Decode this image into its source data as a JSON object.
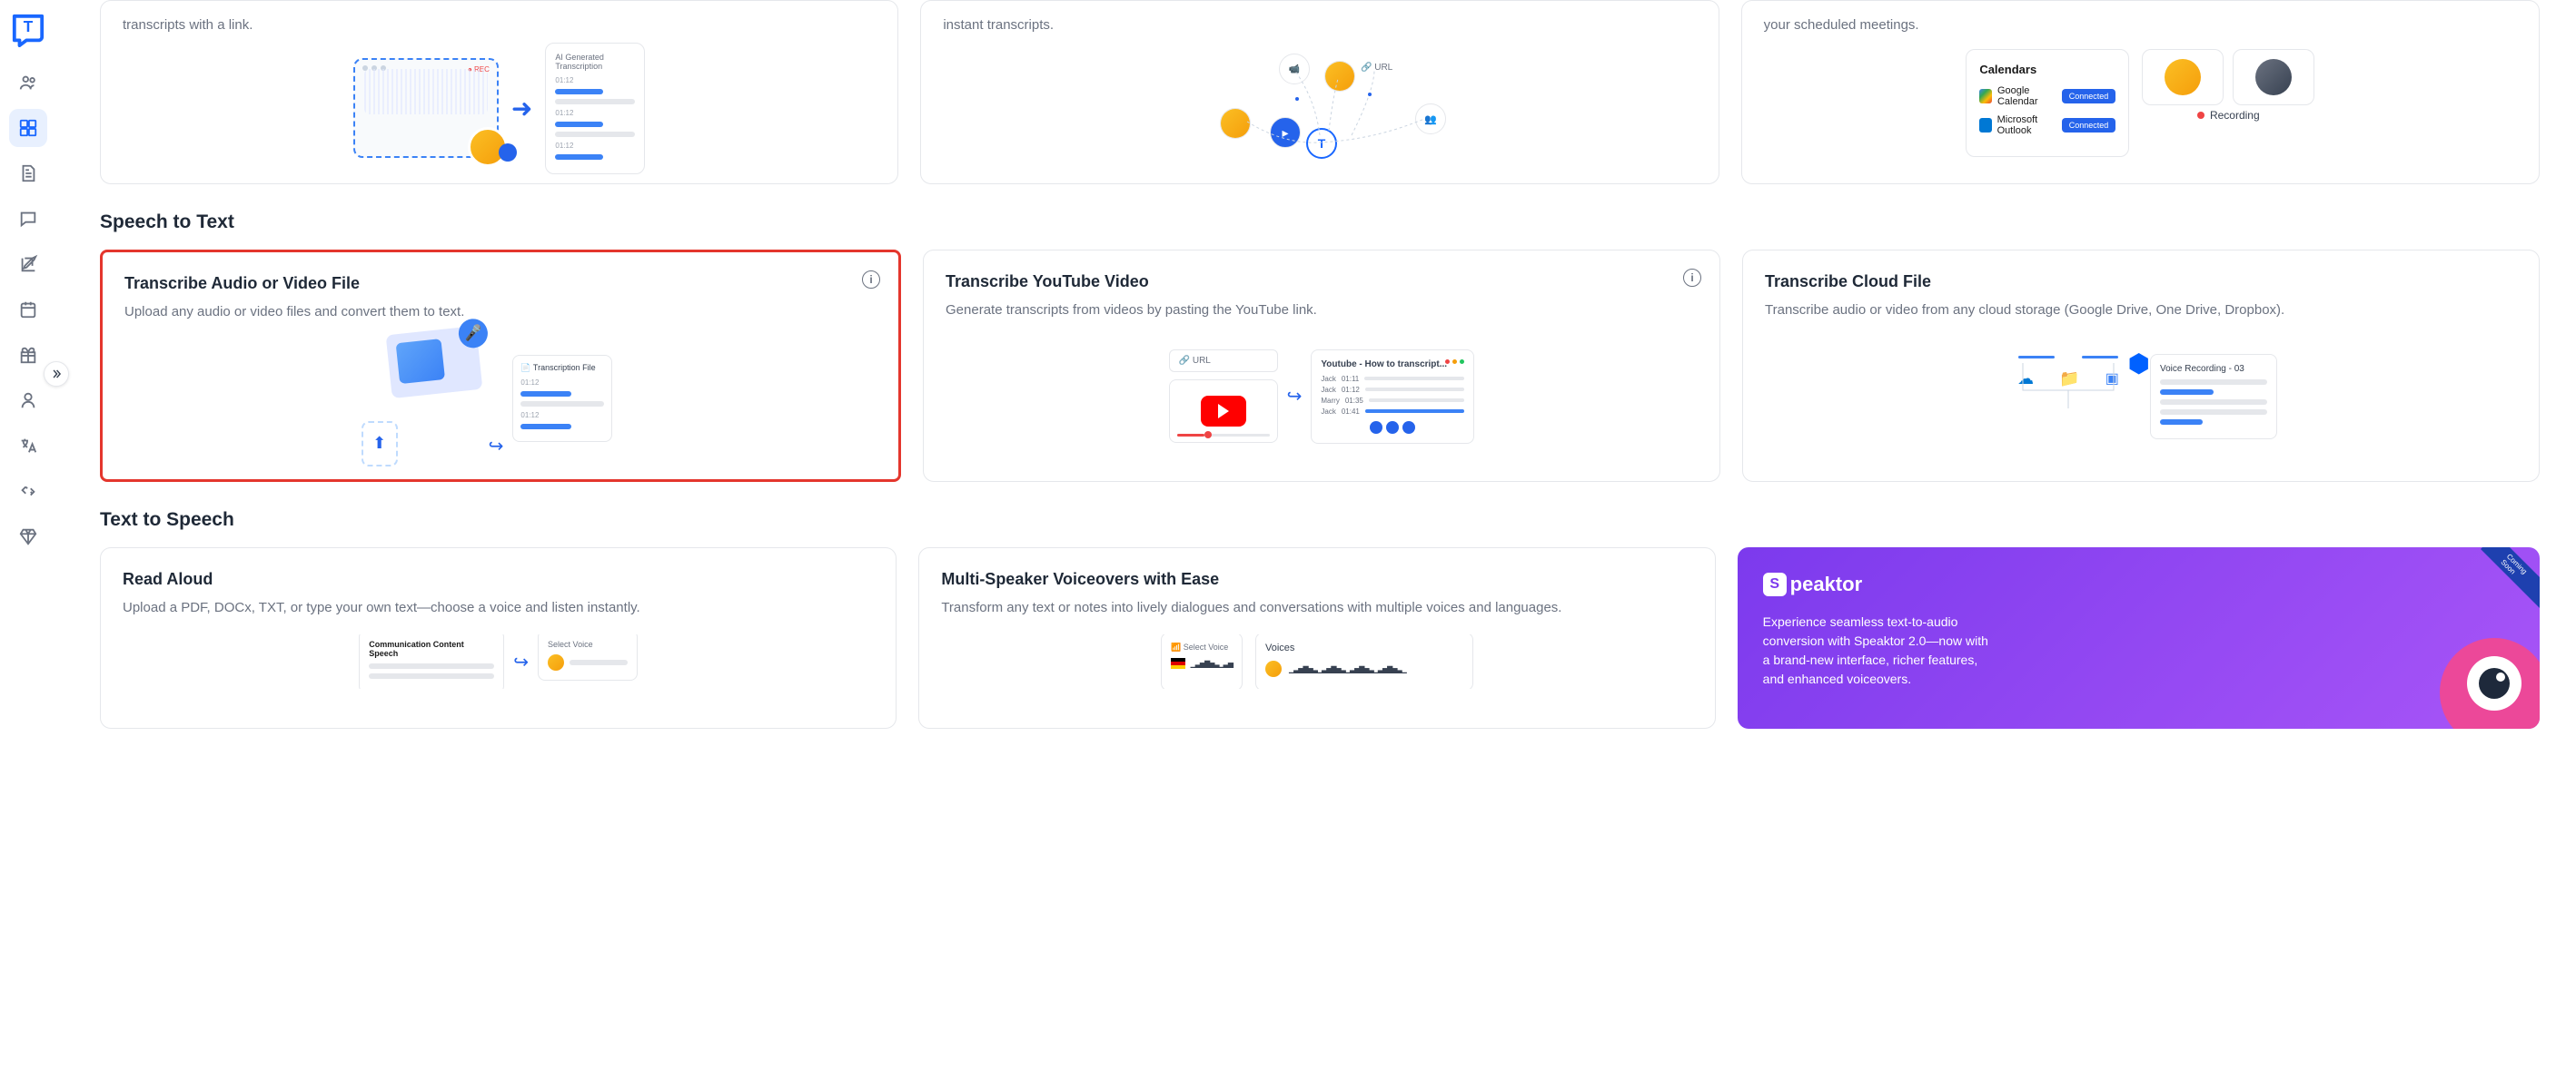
{
  "sidebar": {
    "icons": [
      "people-icon",
      "dashboard-icon",
      "document-icon",
      "chat-icon",
      "edit-icon",
      "calendar-icon",
      "gift-icon",
      "profile-icon",
      "translate-icon",
      "plug-icon",
      "diamond-icon"
    ]
  },
  "top_row": {
    "card1": {
      "desc_fragment": "transcripts with a link.",
      "trans_title": "AI Generated Transcription",
      "rec": "● REC",
      "times": [
        "01:12",
        "01:12",
        "01:12"
      ]
    },
    "card2": {
      "desc_fragment": "instant transcripts.",
      "url_label": "URL"
    },
    "card3": {
      "desc_fragment": "your scheduled meetings.",
      "calendars_title": "Calendars",
      "google": "Google Calendar",
      "outlook": "Microsoft Outlook",
      "connected": "Connected",
      "recording": "Recording"
    }
  },
  "section_speech": "Speech to Text",
  "speech_cards": {
    "c1": {
      "title": "Transcribe Audio or Video File",
      "desc": "Upload any audio or video files and convert them to text.",
      "trans_label": "Transcription File",
      "times": [
        "01:12",
        "01:12"
      ]
    },
    "c2": {
      "title": "Transcribe YouTube Video",
      "desc": "Generate transcripts from videos by pasting the YouTube link.",
      "url_label": "URL",
      "yt_title": "Youtube - How to transcript...",
      "rows": [
        {
          "name": "Jack",
          "time": "01:11"
        },
        {
          "name": "Jack",
          "time": "01:12"
        },
        {
          "name": "Marry",
          "time": "01:35"
        },
        {
          "name": "Jack",
          "time": "01:41"
        }
      ]
    },
    "c3": {
      "title": "Transcribe Cloud File",
      "desc": "Transcribe audio or video from any cloud storage (Google Drive, One Drive, Dropbox).",
      "rec_label": "Voice Recording - 03"
    }
  },
  "section_tts": "Text to Speech",
  "tts_cards": {
    "c1": {
      "title": "Read Aloud",
      "desc": "Upload a PDF, DOCx, TXT, or type your own text—choose a voice and listen instantly.",
      "box_title": "Communication Content Speech",
      "voice_label": "Select Voice"
    },
    "c2": {
      "title": "Multi-Speaker Voiceovers with Ease",
      "desc": "Transform any text or notes into lively dialogues and conversations with multiple voices and languages.",
      "select_voice": "Select Voice",
      "voices_label": "Voices"
    },
    "promo": {
      "logo": "peaktor",
      "badge": "Coming Soon",
      "desc": "Experience seamless text-to-audio conversion with Speaktor 2.0—now with a brand-new interface, richer features, and enhanced voiceovers."
    }
  }
}
